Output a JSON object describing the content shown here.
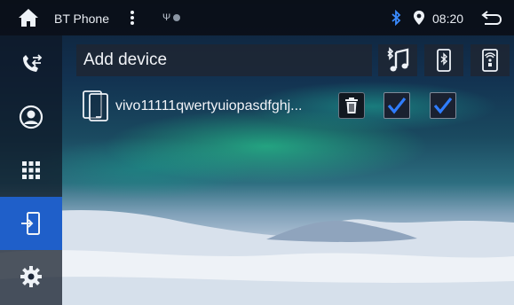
{
  "status_bar": {
    "app_title": "BT Phone",
    "usb_glyph": "Ψ",
    "time": "08:20",
    "icons": [
      "home-icon",
      "menu-kebab-icon",
      "usb-icon",
      "status-dot-icon",
      "bluetooth-icon",
      "location-icon",
      "back-icon"
    ]
  },
  "sidebar": {
    "items": [
      {
        "name": "call-log",
        "icon": "phone-transfer-icon",
        "active": false
      },
      {
        "name": "contacts",
        "icon": "contact-person-icon",
        "active": false
      },
      {
        "name": "dialpad",
        "icon": "dialpad-grid-icon",
        "active": false
      },
      {
        "name": "devices",
        "icon": "device-connect-icon",
        "active": true
      },
      {
        "name": "settings",
        "icon": "gear-icon",
        "active": false
      }
    ]
  },
  "main": {
    "add_device_label": "Add device",
    "toolbar_icons": [
      "music-note-icon",
      "bluetooth-phone-icon",
      "phone-signal-icon"
    ],
    "devices": [
      {
        "name": "vivo11111qwertyuiopasdfghj...",
        "connected_audio": true,
        "connected_phone": true
      }
    ]
  },
  "colors": {
    "accent": "#1f5fc9",
    "check": "#2f7dff",
    "bluetooth": "#3a8bff"
  }
}
